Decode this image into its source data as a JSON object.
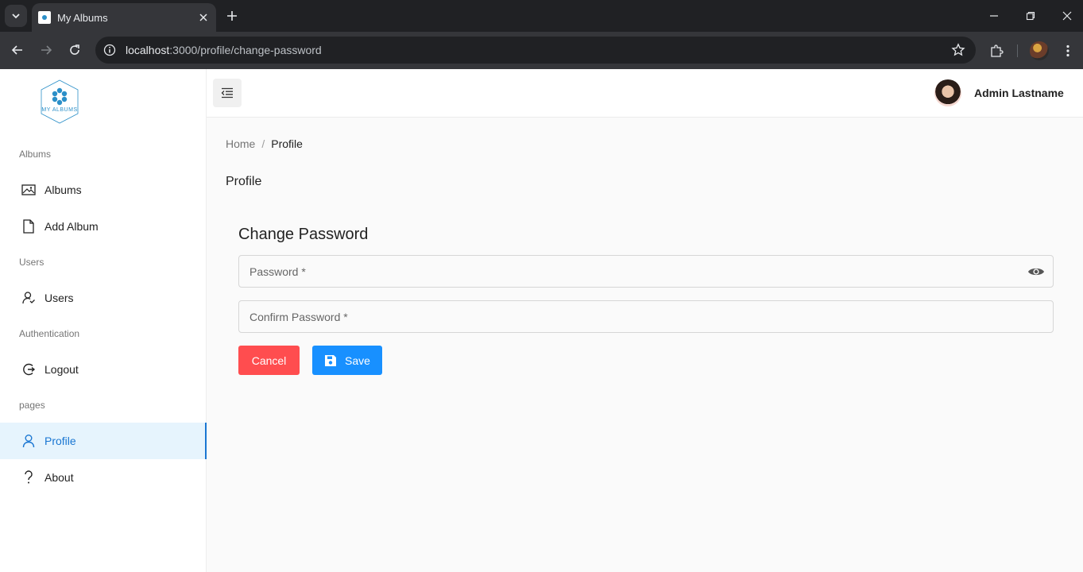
{
  "browser": {
    "tab_title": "My Albums",
    "url_host": "localhost",
    "url_path": ":3000/profile/change-password"
  },
  "sidebar": {
    "logo_text": "MY ALBUMS",
    "sections": [
      {
        "label": "Albums"
      },
      {
        "label": "Users"
      },
      {
        "label": "Authentication"
      },
      {
        "label": "pages"
      }
    ],
    "items": [
      {
        "label": "Albums",
        "icon": "image-icon"
      },
      {
        "label": "Add Album",
        "icon": "file-icon"
      },
      {
        "label": "Users",
        "icon": "users-icon"
      },
      {
        "label": "Logout",
        "icon": "logout-icon"
      },
      {
        "label": "Profile",
        "icon": "user-icon",
        "active": true
      },
      {
        "label": "About",
        "icon": "question-icon"
      }
    ]
  },
  "header": {
    "user_name": "Admin Lastname"
  },
  "breadcrumb": {
    "home": "Home",
    "separator": "/",
    "current": "Profile"
  },
  "page": {
    "title": "Profile",
    "card_title": "Change Password",
    "password_placeholder": "Password *",
    "confirm_placeholder": "Confirm Password *",
    "cancel_label": "Cancel",
    "save_label": "Save"
  },
  "colors": {
    "accent": "#1890ff",
    "danger": "#ff4d4f",
    "active_nav_bg": "#e6f4fd",
    "active_nav_text": "#1976d2"
  }
}
